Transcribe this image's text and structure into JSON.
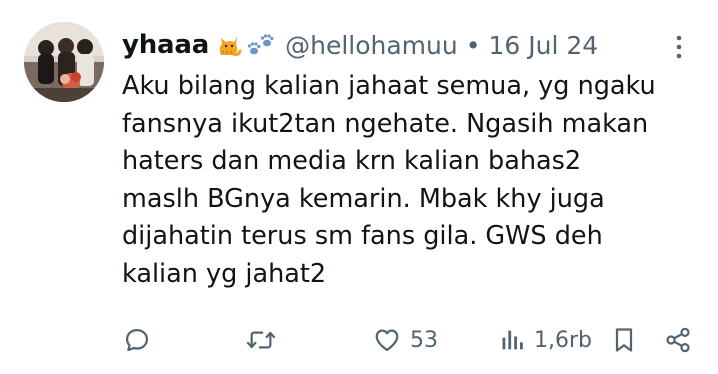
{
  "tweet": {
    "author": {
      "display_name": "yhaaa",
      "emojis": [
        "cat-emoji",
        "paw-prints-emoji"
      ],
      "handle": "@hellohamuu"
    },
    "separator": "•",
    "date": "16 Jul 24",
    "text_lines": [
      "Aku bilang kalian jahaat semua, yg ngaku",
      "fansnya ikut2tan ngehate. Ngasih makan",
      "haters dan media krn kalian bahas2",
      "maslh BGnya kemarin. Mbak khy juga",
      "dijahatin terus sm fans gila. GWS deh",
      "kalian yg jahat2"
    ],
    "actions": {
      "reply": {
        "icon": "reply-icon"
      },
      "retweet": {
        "icon": "retweet-icon"
      },
      "like": {
        "icon": "heart-icon",
        "count": "53"
      },
      "views": {
        "icon": "views-icon",
        "count": "1,6rb"
      },
      "bookmark": {
        "icon": "bookmark-icon"
      },
      "share": {
        "icon": "share-icon"
      }
    },
    "more_icon": "more-vertical-icon"
  },
  "colors": {
    "text_primary": "#0f1419",
    "text_secondary": "#536471",
    "background": "#ffffff"
  }
}
